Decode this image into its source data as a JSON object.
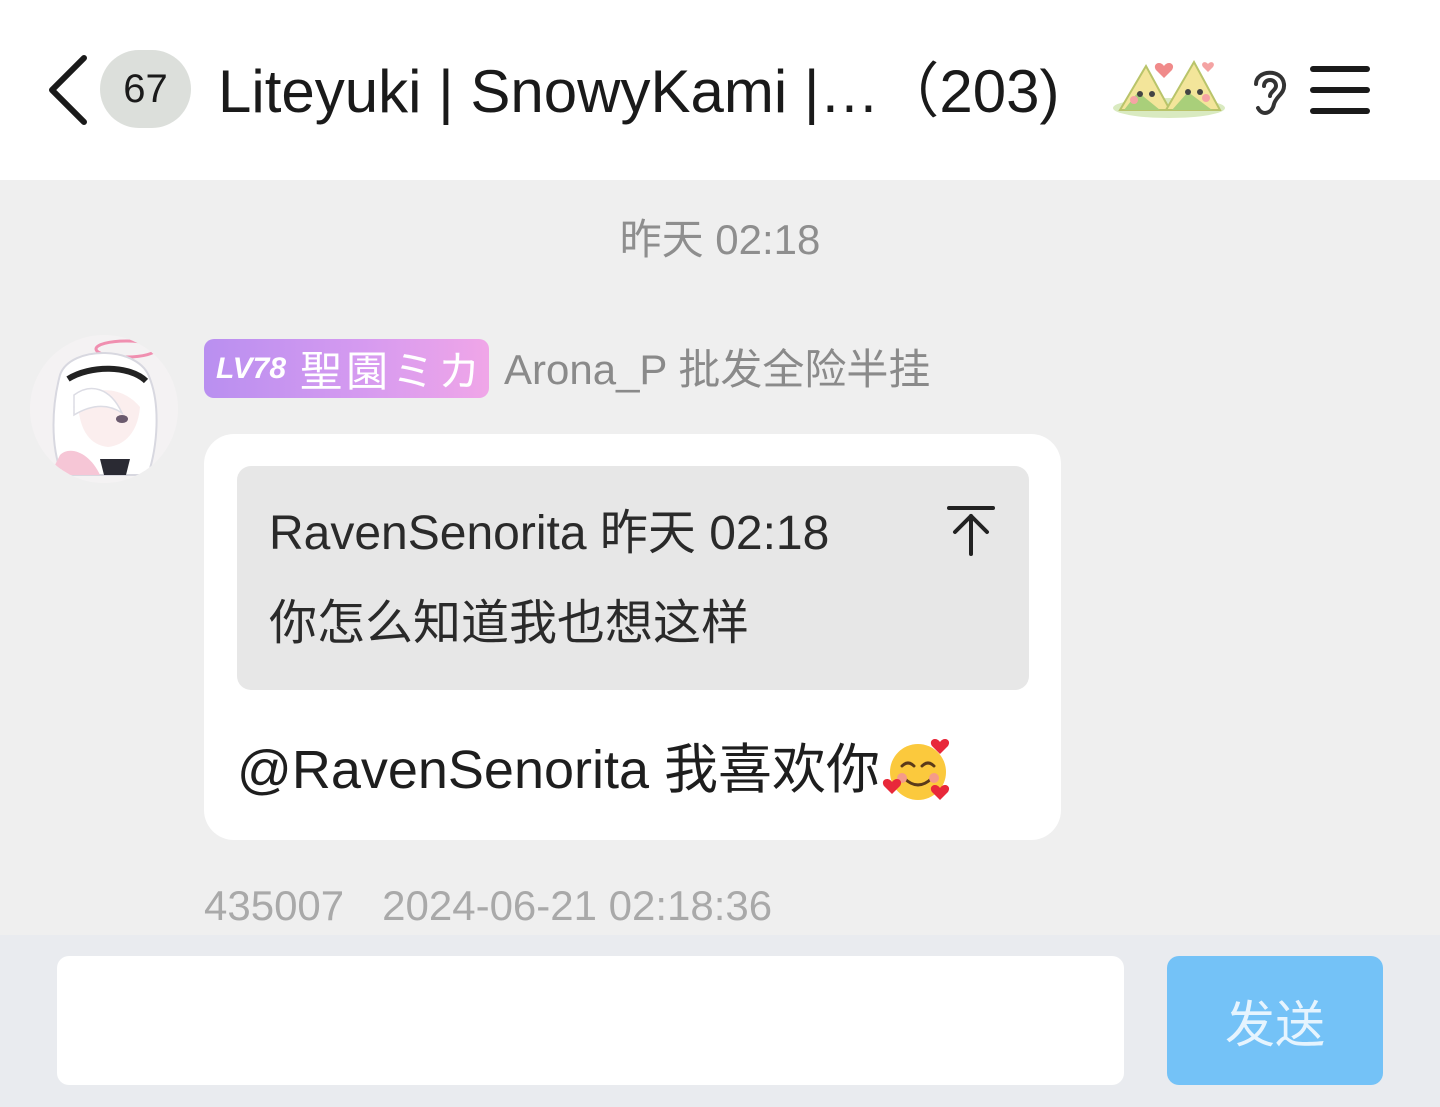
{
  "header": {
    "back_icon": "chevron-left-icon",
    "unread_count": "67",
    "title": "Liteyuki | SnowyKami |…（203)",
    "sticker_icon": "rice-dumpling-sticker",
    "ear_icon": "ear-icon",
    "menu_icon": "hamburger-menu-icon"
  },
  "chat": {
    "time_divider": "昨天 02:18",
    "message": {
      "level": "LV78",
      "member_title": "聖園ミカ",
      "sender": "Arona_P 批发全险半挂",
      "quote": {
        "author_time": "RavenSenorita 昨天 02:18",
        "jump_icon": "jump-to-top-icon",
        "text": "你怎么知道我也想这样"
      },
      "mention": "@RavenSenorita",
      "text": " 我喜欢你",
      "emoji": "smiling-face-with-hearts-emoji",
      "msg_id": "435007",
      "timestamp": "2024-06-21 02:18:36"
    }
  },
  "input_bar": {
    "placeholder": "",
    "send_label": "发送"
  },
  "colors": {
    "header_bg": "#ffffff",
    "chat_bg": "#efefef",
    "bubble_bg": "#ffffff",
    "quote_bg": "#e7e7e7",
    "send_button": "#74c2f7",
    "level_badge_start": "#b98ff0",
    "level_badge_end": "#f0a6e8"
  }
}
